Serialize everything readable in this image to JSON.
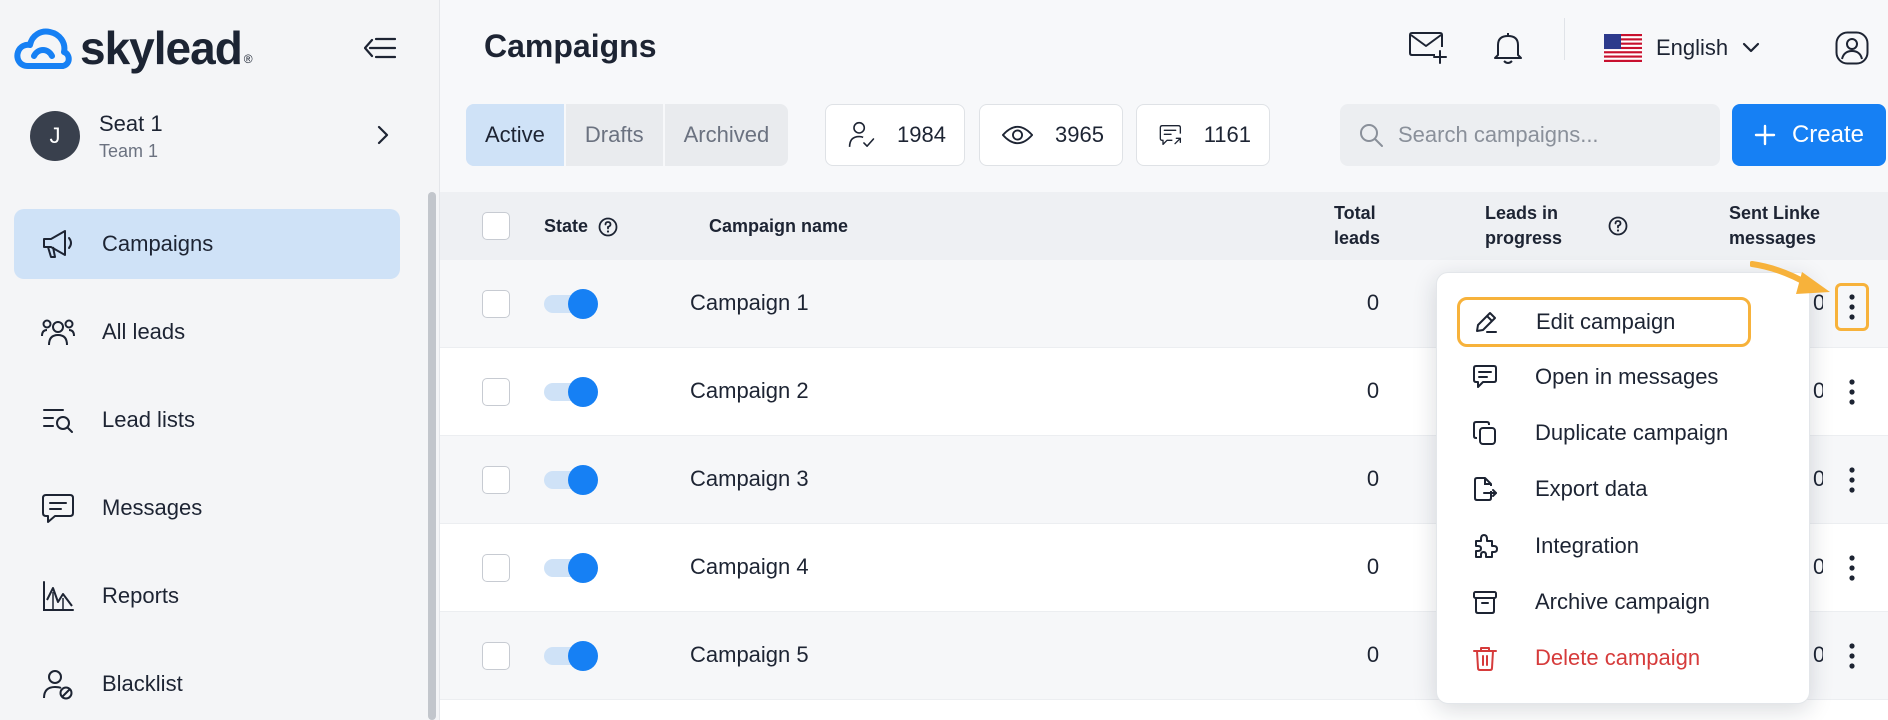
{
  "brand": {
    "name": "skylead",
    "reg_mark": "®"
  },
  "seat": {
    "initial": "J",
    "name": "Seat 1",
    "team": "Team 1"
  },
  "sidebar": {
    "items": [
      {
        "label": "Campaigns",
        "icon": "megaphone-icon",
        "active": true
      },
      {
        "label": "All leads",
        "icon": "users-icon"
      },
      {
        "label": "Lead lists",
        "icon": "list-search-icon"
      },
      {
        "label": "Messages",
        "icon": "message-icon"
      },
      {
        "label": "Reports",
        "icon": "chart-icon"
      },
      {
        "label": "Blacklist",
        "icon": "user-blocked-icon"
      }
    ]
  },
  "header": {
    "title": "Campaigns",
    "language": "English",
    "tabs": [
      {
        "label": "Active",
        "active": true
      },
      {
        "label": "Drafts"
      },
      {
        "label": "Archived"
      }
    ],
    "stats": [
      {
        "icon": "user-check-icon",
        "value": "1984"
      },
      {
        "icon": "eye-icon",
        "value": "3965"
      },
      {
        "icon": "message-arrow-icon",
        "value": "1161"
      }
    ],
    "search_placeholder": "Search campaigns...",
    "create_label": "Create"
  },
  "table": {
    "columns": {
      "state": "State",
      "name": "Campaign name",
      "total_leads": [
        "Total",
        "leads"
      ],
      "in_progress": [
        "Leads in",
        "progress"
      ],
      "sent": [
        "Sent Linke",
        "messages"
      ]
    },
    "rows": [
      {
        "name": "Campaign 1",
        "total_leads": "0",
        "sent": "0"
      },
      {
        "name": "Campaign 2",
        "total_leads": "0",
        "sent": "0"
      },
      {
        "name": "Campaign 3",
        "total_leads": "0",
        "sent": "0"
      },
      {
        "name": "Campaign 4",
        "total_leads": "0",
        "sent": "0"
      },
      {
        "name": "Campaign 5",
        "total_leads": "0",
        "sent": "0"
      }
    ]
  },
  "menu": {
    "items": [
      {
        "label": "Edit campaign",
        "icon": "pencil-icon",
        "highlighted": true
      },
      {
        "label": "Open in messages",
        "icon": "message-icon"
      },
      {
        "label": "Duplicate campaign",
        "icon": "copy-icon"
      },
      {
        "label": "Export data",
        "icon": "file-export-icon"
      },
      {
        "label": "Integration",
        "icon": "puzzle-icon"
      },
      {
        "label": "Archive campaign",
        "icon": "archive-icon"
      },
      {
        "label": "Delete campaign",
        "icon": "trash-icon",
        "danger": true
      }
    ]
  },
  "colors": {
    "accent": "#1680f4",
    "highlight": "#f7b23b",
    "danger": "#d63b3b",
    "active_bg": "#cfe2f7"
  }
}
